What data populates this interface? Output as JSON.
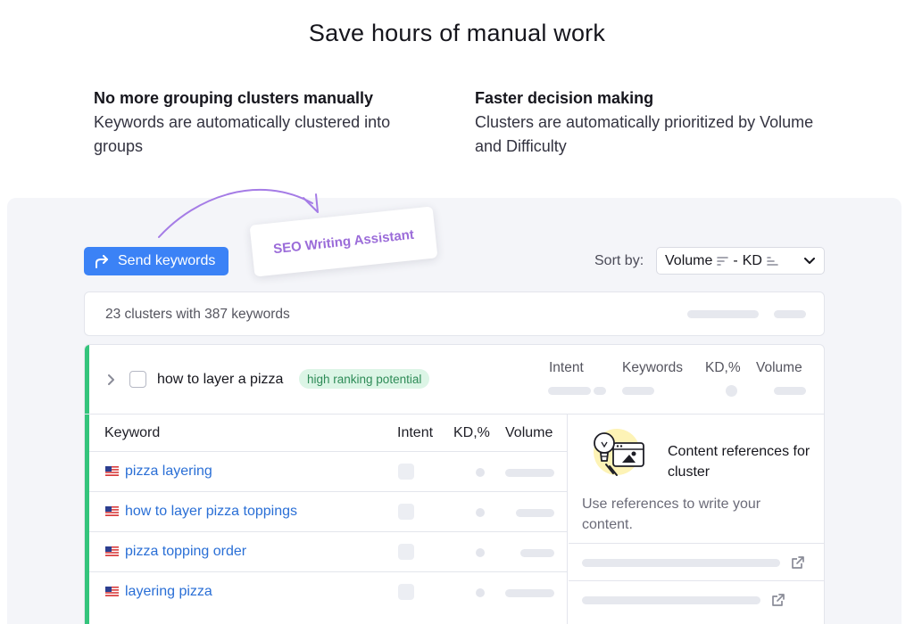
{
  "headline": "Save hours of manual work",
  "features": [
    {
      "title": "No more grouping clusters manually",
      "desc": "Keywords are automatically clustered into groups"
    },
    {
      "title": "Faster decision making",
      "desc": "Clusters are automatically prioritized by Volume and Difficulty"
    }
  ],
  "toolbar": {
    "send_label": "Send keywords",
    "tool_tag": "SEO Writing Assistant",
    "sort_label": "Sort by:",
    "sort_primary": "Volume",
    "sort_separator": "-",
    "sort_secondary": "KD"
  },
  "summary": {
    "text": "23 clusters with 387 keywords"
  },
  "cluster": {
    "title": "how to layer a pizza",
    "badge": "high ranking potential",
    "columns": {
      "intent": "Intent",
      "keywords": "Keywords",
      "kd": "KD,%",
      "volume": "Volume"
    }
  },
  "keywords_table": {
    "headers": {
      "keyword": "Keyword",
      "intent": "Intent",
      "kd": "KD,%",
      "volume": "Volume"
    },
    "rows": [
      {
        "keyword": "pizza layering"
      },
      {
        "keyword": "how to layer pizza toppings"
      },
      {
        "keyword": "pizza topping order"
      },
      {
        "keyword": "layering pizza"
      }
    ]
  },
  "references": {
    "title": "Content references for cluster",
    "desc": "Use references to write your content."
  },
  "colors": {
    "primary": "#3b82f6",
    "accent_green": "#34c47c",
    "badge_bg": "#dcf5e6",
    "link": "#2a6fd6",
    "tag_purple": "#9b6cd9"
  }
}
